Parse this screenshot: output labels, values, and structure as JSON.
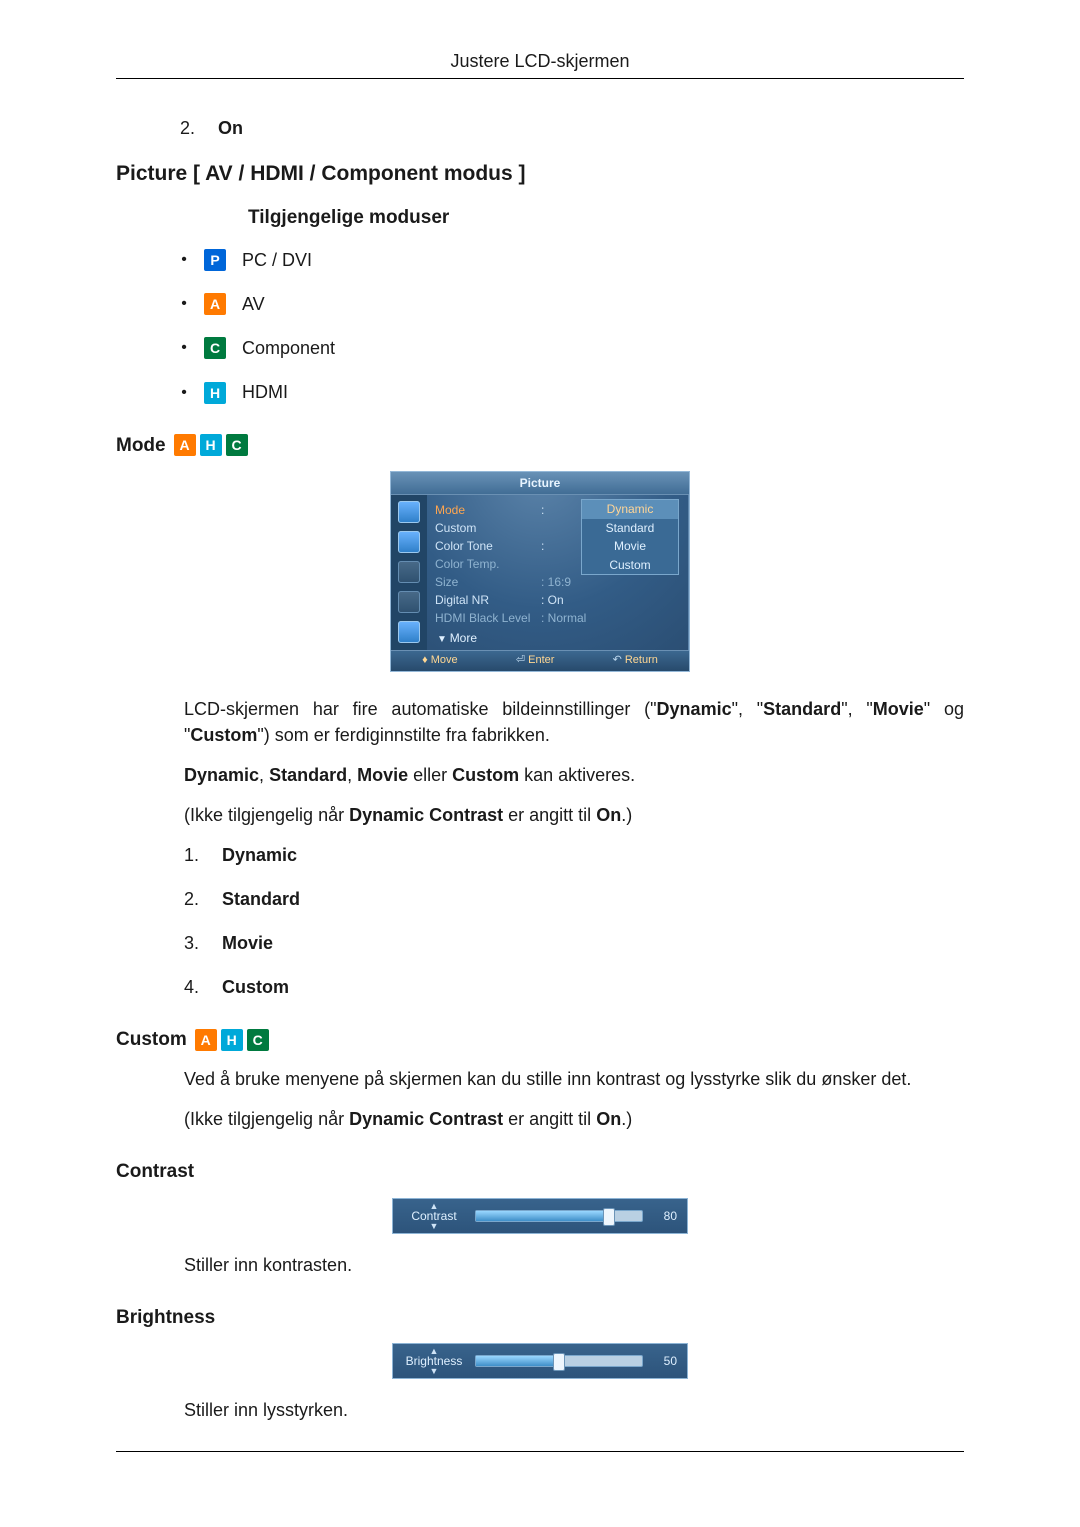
{
  "header": {
    "title": "Justere LCD-skjermen"
  },
  "intro_list": [
    {
      "num": "2.",
      "label": "On"
    }
  ],
  "section_picture": {
    "title": "Picture [ AV / HDMI / Component modus ]"
  },
  "available_modes": {
    "title": "Tilgjengelige moduser",
    "items": [
      {
        "badge": "P",
        "label": "PC / DVI"
      },
      {
        "badge": "A",
        "label": "AV"
      },
      {
        "badge": "C",
        "label": "Component"
      },
      {
        "badge": "H",
        "label": "HDMI"
      }
    ]
  },
  "mode_section": {
    "title": "Mode",
    "badges": [
      "A",
      "H",
      "C"
    ],
    "osd": {
      "title": "Picture",
      "rows": [
        {
          "label": "Mode",
          "value": "",
          "hi": true
        },
        {
          "label": "Custom",
          "value": "",
          "hi": false
        },
        {
          "label": "Color Tone",
          "value": "",
          "hi": false
        },
        {
          "label": "Color Temp.",
          "value": "",
          "dim": true
        },
        {
          "label": "Size",
          "value": ": 16:9",
          "dim": true
        },
        {
          "label": "Digital NR",
          "value": ": On",
          "hi": false
        },
        {
          "label": "HDMI Black Level",
          "value": ": Normal",
          "dim": true
        }
      ],
      "dropdown": [
        "Dynamic",
        "Standard",
        "Movie",
        "Custom"
      ],
      "dropdown_selected": "Dynamic",
      "more": "More",
      "footer": {
        "move": "Move",
        "enter": "Enter",
        "return": "Return"
      }
    },
    "para1_plain1": "LCD-skjermen har fire automatiske bildeinnstillinger (\"",
    "para1_b1": "Dynamic",
    "para1_plain2": "\", \"",
    "para1_b2": "Standard",
    "para1_plain3": "\", \"",
    "para1_b3": "Movie",
    "para1_plain4": "\" og \"",
    "para1_b4": "Custom",
    "para1_plain5": "\") som er ferdiginnstilte fra fabrikken.",
    "para2_b1": "Dynamic",
    "para2_sep": ", ",
    "para2_b2": "Standard",
    "para2_b3": "Movie",
    "para2_mid": " eller ",
    "para2_b4": "Custom",
    "para2_tail": " kan aktiveres.",
    "para3_pre": "(Ikke tilgjengelig når ",
    "para3_b": "Dynamic Contrast",
    "para3_mid": " er angitt til ",
    "para3_on": "On",
    "para3_post": ".)",
    "numlist": [
      {
        "num": "1.",
        "label": "Dynamic"
      },
      {
        "num": "2.",
        "label": "Standard"
      },
      {
        "num": "3.",
        "label": "Movie"
      },
      {
        "num": "4.",
        "label": "Custom"
      }
    ]
  },
  "custom_section": {
    "title": "Custom",
    "badges": [
      "A",
      "H",
      "C"
    ],
    "para1": "Ved å bruke menyene på skjermen kan du stille inn kontrast og lysstyrke slik du ønsker det.",
    "para2_pre": "(Ikke tilgjengelig når ",
    "para2_b": "Dynamic Contrast",
    "para2_mid": " er angitt til ",
    "para2_on": "On",
    "para2_post": ".)"
  },
  "contrast_section": {
    "title": "Contrast",
    "slider": {
      "label": "Contrast",
      "value": 80,
      "max": 100
    },
    "desc": "Stiller inn kontrasten."
  },
  "brightness_section": {
    "title": "Brightness",
    "slider": {
      "label": "Brightness",
      "value": 50,
      "max": 100
    },
    "desc": "Stiller inn lysstyrken."
  }
}
